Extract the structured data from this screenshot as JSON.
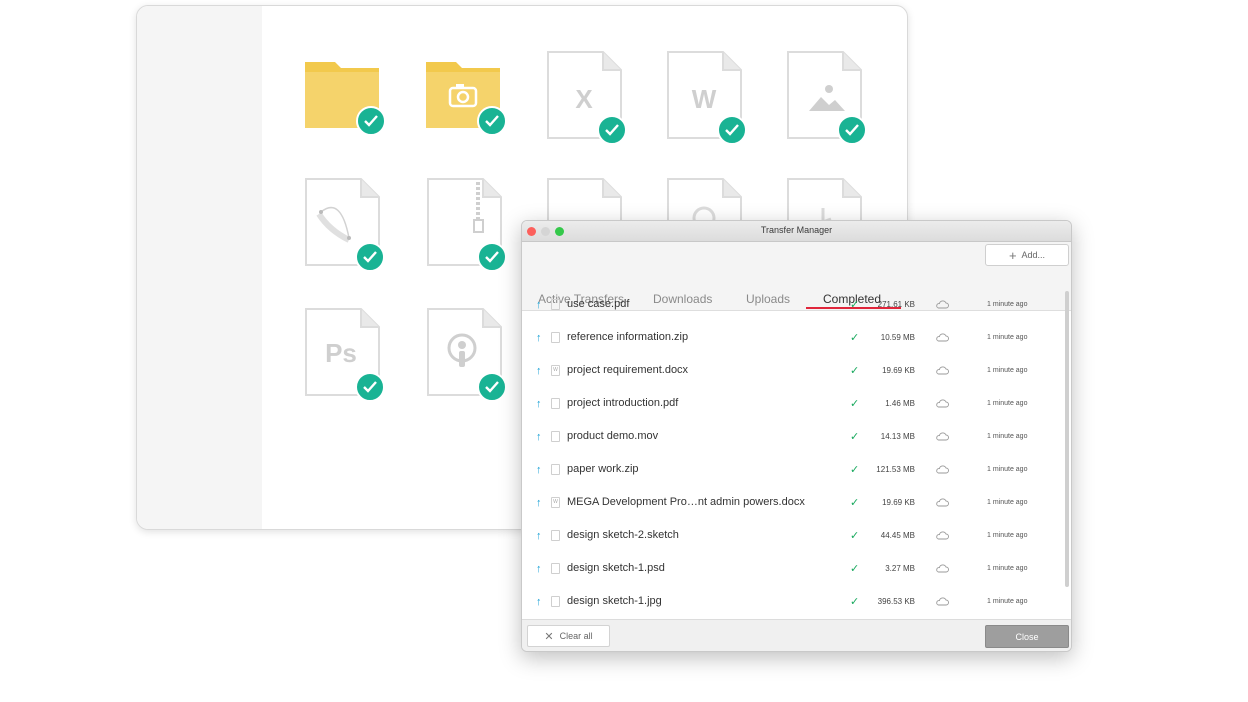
{
  "window": {
    "title": "Transfer Manager"
  },
  "toolbar": {
    "add_label": "Add..."
  },
  "tabs": [
    {
      "label": "Active Transfers"
    },
    {
      "label": "Downloads"
    },
    {
      "label": "Uploads"
    },
    {
      "label": "Completed"
    }
  ],
  "transfers": [
    {
      "name": "use case.pdf",
      "size": "271.61 KB",
      "time": "1 minute ago"
    },
    {
      "name": "reference information.zip",
      "size": "10.59 MB",
      "time": "1 minute ago"
    },
    {
      "name": "project requirement.docx",
      "size": "19.69 KB",
      "time": "1 minute ago"
    },
    {
      "name": "project introduction.pdf",
      "size": "1.46 MB",
      "time": "1 minute ago"
    },
    {
      "name": "product demo.mov",
      "size": "14.13 MB",
      "time": "1 minute ago"
    },
    {
      "name": "paper work.zip",
      "size": "121.53 MB",
      "time": "1 minute ago"
    },
    {
      "name": "MEGA Development Pro…nt admin powers.docx",
      "size": "19.69 KB",
      "time": "1 minute ago"
    },
    {
      "name": "design sketch-2.sketch",
      "size": "44.45 MB",
      "time": "1 minute ago"
    },
    {
      "name": "design sketch-1.psd",
      "size": "3.27 MB",
      "time": "1 minute ago"
    },
    {
      "name": "design sketch-1.jpg",
      "size": "396.53 KB",
      "time": "1 minute ago"
    }
  ],
  "footer": {
    "clear_label": "Clear all",
    "close_label": "Close"
  },
  "grid_tiles": [
    {
      "icon": "folder-icon"
    },
    {
      "icon": "camera-folder-icon"
    },
    {
      "icon": "excel-file-icon",
      "glyph": "X"
    },
    {
      "icon": "word-file-icon",
      "glyph": "W"
    },
    {
      "icon": "image-file-icon"
    },
    {
      "icon": "vector-file-icon"
    },
    {
      "icon": "zip-file-icon"
    },
    {
      "icon": "photoshop-file-icon",
      "glyph": "Ps"
    },
    {
      "icon": "podcast-file-icon"
    }
  ],
  "colors": {
    "accent": "#e0263b",
    "check": "#19b394",
    "upload_arrow": "#1aa1d6",
    "folder": "#f5d36b"
  }
}
